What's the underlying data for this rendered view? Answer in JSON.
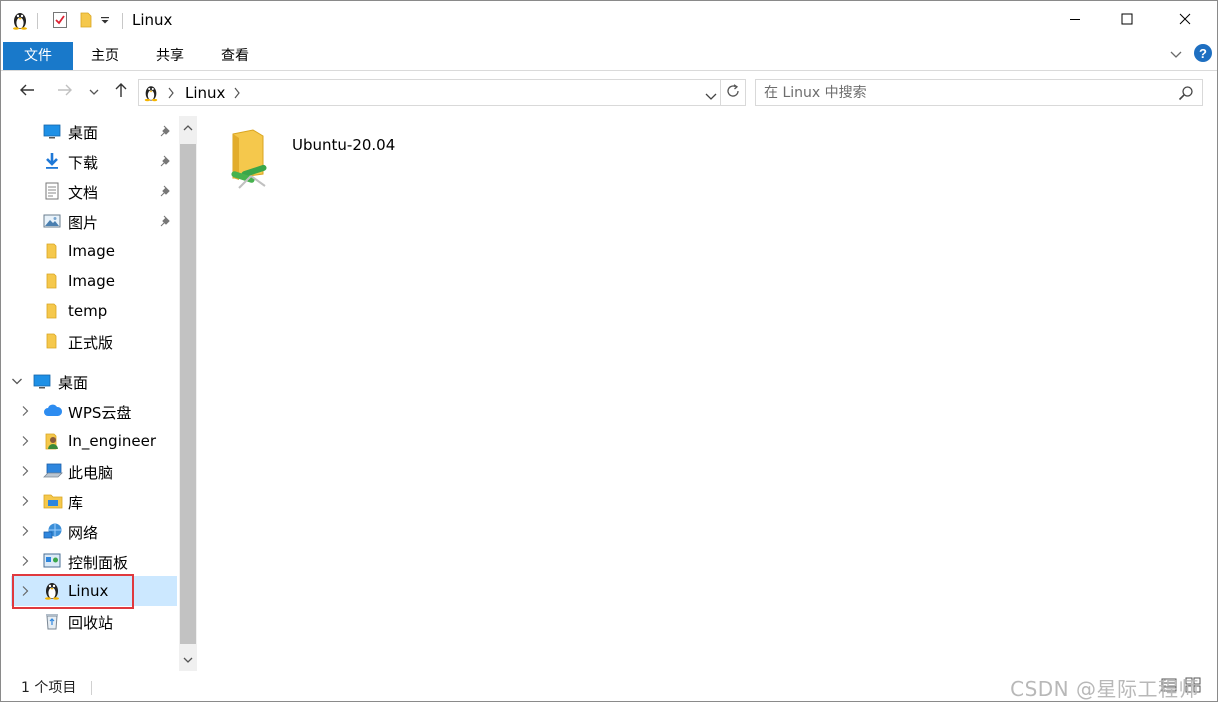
{
  "window": {
    "title": "Linux",
    "controls": {
      "minimize": "minimize-icon",
      "maximize": "maximize-icon",
      "close": "close-icon"
    }
  },
  "ribbon": {
    "tabs": [
      {
        "label": "文件",
        "active": true
      },
      {
        "label": "主页"
      },
      {
        "label": "共享"
      },
      {
        "label": "查看"
      }
    ]
  },
  "address": {
    "path": "Linux",
    "separator": ">"
  },
  "search": {
    "placeholder": "在 Linux 中搜索"
  },
  "nav_pane": {
    "quick_access": [
      {
        "label": "桌面",
        "icon": "desktop-icon",
        "pinned": true
      },
      {
        "label": "下载",
        "icon": "download-icon",
        "pinned": true
      },
      {
        "label": "文档",
        "icon": "document-icon",
        "pinned": true
      },
      {
        "label": "图片",
        "icon": "pictures-icon",
        "pinned": true
      },
      {
        "label": "Image",
        "icon": "folder-icon"
      },
      {
        "label": "Image",
        "icon": "folder-icon"
      },
      {
        "label": "temp",
        "icon": "folder-icon"
      },
      {
        "label": "正式版",
        "icon": "folder-icon"
      }
    ],
    "desktop_root": {
      "label": "桌面",
      "icon": "desktop-icon",
      "expanded": true
    },
    "desktop_children": [
      {
        "label": "WPS云盘",
        "icon": "cloud-icon"
      },
      {
        "label": "In_engineer",
        "icon": "user-icon"
      },
      {
        "label": "此电脑",
        "icon": "computer-icon"
      },
      {
        "label": "库",
        "icon": "library-icon"
      },
      {
        "label": "网络",
        "icon": "network-icon"
      },
      {
        "label": "控制面板",
        "icon": "control-panel-icon"
      },
      {
        "label": "Linux",
        "icon": "linux-penguin-icon",
        "selected": true
      },
      {
        "label": "回收站",
        "icon": "recycle-bin-icon"
      }
    ]
  },
  "content": {
    "items": [
      {
        "name": "Ubuntu-20.04",
        "icon": "network-folder-icon"
      }
    ]
  },
  "status": {
    "item_count": "1 个项目"
  },
  "watermark": {
    "text": "CSDN @星际工程师"
  },
  "colors": {
    "accent": "#1979ca",
    "selection": "#cce8ff",
    "highlight_border": "#e0393e",
    "folder_yellow": "#f5c84c"
  }
}
